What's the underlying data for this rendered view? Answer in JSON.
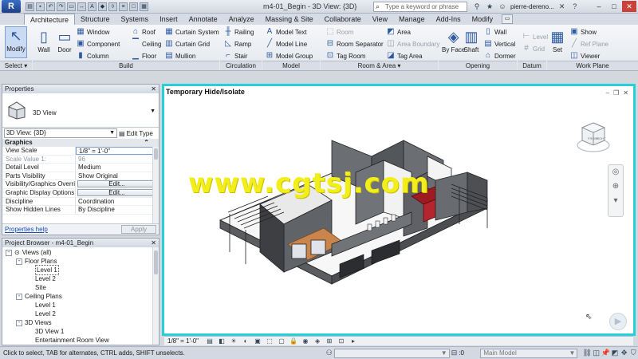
{
  "titlebar": {
    "app_letter": "R",
    "title": "m4-01_Begin - 3D View: {3D}",
    "search_placeholder": "Type a keyword or phrase",
    "user": "pierre-dereno..."
  },
  "tabs": [
    "Architecture",
    "Structure",
    "Systems",
    "Insert",
    "Annotate",
    "Analyze",
    "Massing & Site",
    "Collaborate",
    "View",
    "Manage",
    "Add-Ins",
    "Modify"
  ],
  "ribbon": {
    "modify": "Modify",
    "wall": "Wall",
    "door": "Door",
    "window": "Window",
    "component": "Component",
    "column": "Column",
    "roof": "Roof",
    "ceiling": "Ceiling",
    "floor": "Floor",
    "curtain_system": "Curtain System",
    "curtain_grid": "Curtain Grid",
    "mullion": "Mullion",
    "railing": "Railing",
    "ramp": "Ramp",
    "stair": "Stair",
    "model_text": "Model Text",
    "model_line": "Model Line",
    "model_group": "Model Group",
    "room": "Room",
    "room_separator": "Room Separator",
    "tag_room": "Tag Room",
    "area": "Area",
    "area_boundary": "Area Boundary",
    "tag_area": "Tag Area",
    "by_face": "By Face",
    "shaft": "Shaft",
    "wall_open": "Wall",
    "vertical": "Vertical",
    "dormer": "Dormer",
    "level": "Level",
    "grid": "Grid",
    "set": "Set",
    "show": "Show",
    "ref_plane": "Ref Plane",
    "viewer": "Viewer",
    "panels": {
      "select": "Select",
      "build": "Build",
      "circulation": "Circulation",
      "model": "Model",
      "room_area": "Room & Area",
      "opening": "Opening",
      "datum": "Datum",
      "work_plane": "Work Plane"
    }
  },
  "properties": {
    "title": "Properties",
    "type_name": "3D View",
    "instance": "3D View: {3D}",
    "edit_type": "Edit Type",
    "group": "Graphics",
    "rows": [
      {
        "k": "View Scale",
        "v": "1/8\" = 1'-0\""
      },
      {
        "k": "Scale Value    1:",
        "v": "96"
      },
      {
        "k": "Detail Level",
        "v": "Medium"
      },
      {
        "k": "Parts Visibility",
        "v": "Show Original"
      },
      {
        "k": "Visibility/Graphics Overri...",
        "v": "Edit..."
      },
      {
        "k": "Graphic Display Options",
        "v": "Edit..."
      },
      {
        "k": "Discipline",
        "v": "Coordination"
      },
      {
        "k": "Show Hidden Lines",
        "v": "By Discipline"
      }
    ],
    "help_link": "Properties help",
    "apply": "Apply"
  },
  "browser": {
    "title": "Project Browser - m4-01_Begin",
    "nodes": [
      {
        "label": "Views (all)",
        "level": 0,
        "toggle": "-"
      },
      {
        "label": "Floor Plans",
        "level": 1,
        "toggle": "-"
      },
      {
        "label": "Level 1",
        "level": 2,
        "toggle": ""
      },
      {
        "label": "Level 2",
        "level": 2,
        "toggle": ""
      },
      {
        "label": "Site",
        "level": 2,
        "toggle": ""
      },
      {
        "label": "Ceiling Plans",
        "level": 1,
        "toggle": "-"
      },
      {
        "label": "Level 1",
        "level": 2,
        "toggle": ""
      },
      {
        "label": "Level 2",
        "level": 2,
        "toggle": ""
      },
      {
        "label": "3D Views",
        "level": 1,
        "toggle": "-"
      },
      {
        "label": "3D View 1",
        "level": 2,
        "toggle": ""
      },
      {
        "label": "Entertainment Room View",
        "level": 2,
        "toggle": ""
      }
    ]
  },
  "view": {
    "hint": "Temporary Hide/Isolate",
    "watermark": "www.cgtsj.com",
    "scale": "1/8\" = 1'-0\"",
    "viewcube_front": "FRONT",
    "viewcube_right": "RIGHT"
  },
  "status": {
    "message": "Click to select, TAB for alternates, CTRL adds, SHIFT unselects.",
    "counter": ":0",
    "workset": "Main Model"
  }
}
